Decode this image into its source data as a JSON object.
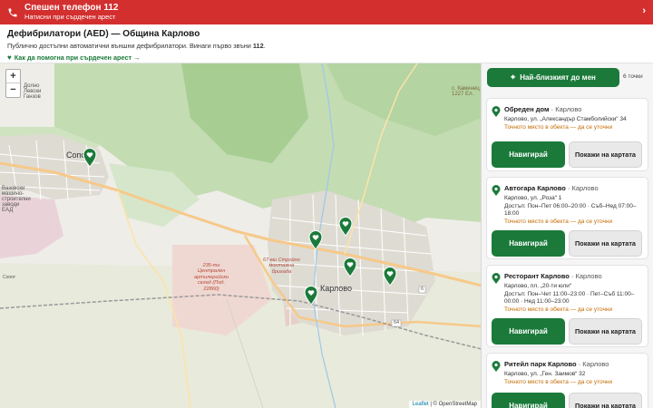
{
  "banner": {
    "title": "Спешен телефон 112",
    "subtitle": "Натисни при сърдечен арест",
    "chevron": "›"
  },
  "header": {
    "title": "Дефибрилатори (AED) — Община Карлово",
    "subtitle_pre": "Публично достъпни автоматични външни дефибрилатори. Винаги първо звъни ",
    "subtitle_num": "112",
    "subtitle_post": ".",
    "help_link": "Как да помогна при сърдечен арест →"
  },
  "map": {
    "zoom_in": "+",
    "zoom_out": "−",
    "attribution_leaflet": "Leaflet",
    "attribution_rest": " | © OpenStreetMap",
    "labels": {
      "sopot": "Сопот",
      "karlovo": "Карлово",
      "dorno": "Долно\nЛевски\nГанзов",
      "kavec": "с. Каменец\n1227 Ел.",
      "sklad": "235-ти\nЦентрален\nартилерийски\nсклад (Под.\n22860)",
      "stroy": "67-ми Стройно\nмонтажна\nбригада",
      "sopot_small": "Сопот",
      "r64": "64",
      "r6": "6",
      "vazovski": "Вазовски\nмашино-\nстроителни\nзаводи\nЕАД"
    }
  },
  "sidebar": {
    "nearest_label": "Най-близкият до мен",
    "count_label": "6 точки",
    "cards": [
      {
        "name": "Обреден дом",
        "city": "Карлово",
        "address": "Карлово, ул. „Александър Стамболийски“ 34",
        "hours": "",
        "warning": "Точното място в обекта — да се уточни",
        "nav": "Навигирай",
        "show": "Покажи на картата"
      },
      {
        "name": "Автогара Карлово",
        "city": "Карлово",
        "address": "Карлово, ул. „Роза“ 1",
        "hours": "Достъп: Пон–Пет 06:00–20:00 · Съб–Нед 07:00–18:00",
        "warning": "Точното място в обекта — да се уточни",
        "nav": "Навигирай",
        "show": "Покажи на картата"
      },
      {
        "name": "Ресторант Карлово",
        "city": "Карлово",
        "address": "Карлово, пл. „20-ти юли“",
        "hours": "Достъп: Пон–Чет 11:00–23:00 · Пет–Съб 11:00–00:00 · Нед 11:00–23:00",
        "warning": "Точното място в обекта — да се уточни",
        "nav": "Навигирай",
        "show": "Покажи на картата"
      },
      {
        "name": "Ритейл парк Карлово",
        "city": "Карлово",
        "address": "Карлово, ул. „Ген. Заимов“ 32",
        "hours": "",
        "warning": "Точното място в обекта — да се уточни",
        "nav": "Навигирай",
        "show": "Покажи на картата"
      }
    ]
  },
  "colors": {
    "emergency_red": "#d32f2f",
    "accent_green": "#1b7a3a",
    "warning_orange": "#c46a00"
  }
}
